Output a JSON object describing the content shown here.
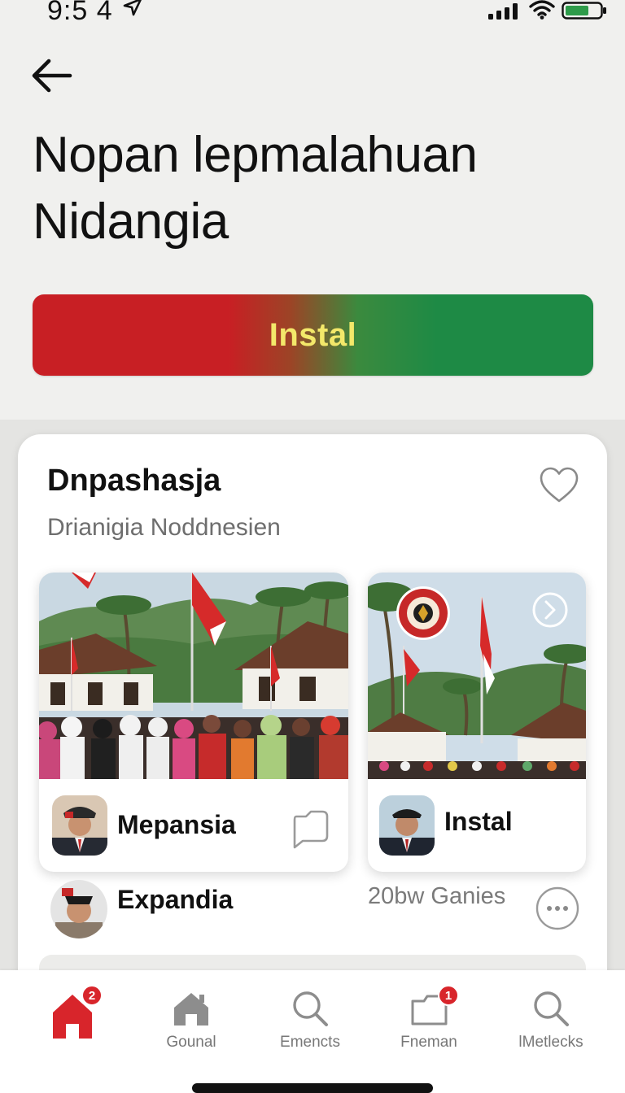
{
  "status_bar": {
    "time": "9:5 4",
    "icons": [
      "location-arrow-icon",
      "signal-icon",
      "wifi-icon",
      "battery-icon"
    ]
  },
  "header": {
    "back_icon": "arrow-left-icon",
    "title": "Nopan lepmalahuan Nidangia"
  },
  "install_button": {
    "label": "Instal"
  },
  "card": {
    "title": "Dnpashasja",
    "subtitle": "Drianigia Noddnesien",
    "favorite_icon": "heart-icon",
    "tiles": [
      {
        "label": "Mepansia",
        "image": "village-crowd-flags-photo",
        "action_icon": "speech-bubble-icon"
      },
      {
        "label": "Instal",
        "image": "village-flags-emblem-photo",
        "action_icon": "chevron-right-circle-icon"
      }
    ],
    "row": {
      "name": "Expandia",
      "meta": "20bw Ganies",
      "more_icon": "more-horizontal-icon"
    }
  },
  "tab_bar": {
    "items": [
      {
        "label": "",
        "icon": "home-icon",
        "active": true,
        "badge": "2"
      },
      {
        "label": "Gounal",
        "icon": "house-icon",
        "active": false,
        "badge": ""
      },
      {
        "label": "Emencts",
        "icon": "search-icon",
        "active": false,
        "badge": ""
      },
      {
        "label": "Fneman",
        "icon": "inbox-icon",
        "active": false,
        "badge": "1"
      },
      {
        "label": "lMetlecks",
        "icon": "search-icon",
        "active": false,
        "badge": ""
      }
    ]
  },
  "colors": {
    "accent_red": "#c81f24",
    "accent_green": "#1e8a45",
    "install_text": "#f3e86a",
    "badge": "#d8252b"
  }
}
